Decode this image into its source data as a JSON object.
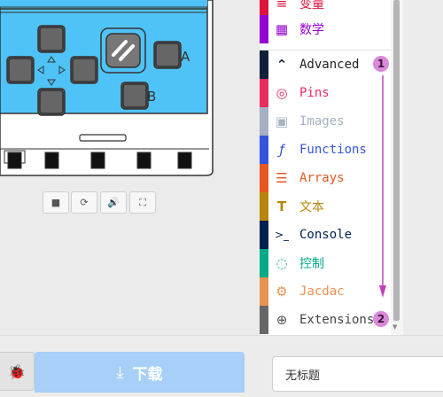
{
  "simulator": {
    "button_a_label": "A",
    "button_b_label": "B",
    "controls": [
      {
        "name": "stop-button",
        "icon": "■"
      },
      {
        "name": "restart-button",
        "icon": "⟳"
      },
      {
        "name": "sound-button",
        "icon": "🔊"
      },
      {
        "name": "fullscreen-button",
        "icon": "⛶"
      }
    ],
    "colors": {
      "board": "#4fc3f7",
      "outline": "#333333"
    }
  },
  "toolbox": {
    "categories": [
      {
        "label": "变量",
        "color": "#dc143c",
        "icon": "≡",
        "partial": true
      },
      {
        "label": "数学",
        "color": "#9400d3",
        "icon": "▦"
      },
      {
        "label": "Advanced",
        "color": "#0f1f3a",
        "icon": "⌃",
        "text_color": "#222222"
      },
      {
        "label": "Pins",
        "color": "#e92c5f",
        "icon": "◎"
      },
      {
        "label": "Images",
        "color": "#a5b1c2",
        "icon": "▣"
      },
      {
        "label": "Functions",
        "color": "#3455db",
        "icon": "ƒ"
      },
      {
        "label": "Arrays",
        "color": "#e65722",
        "icon": "☰"
      },
      {
        "label": "文本",
        "color": "#b8860b",
        "icon": "T"
      },
      {
        "label": "Console",
        "color": "#002050",
        "icon": ">_"
      },
      {
        "label": "控制",
        "color": "#00aa88",
        "icon": "◌"
      },
      {
        "label": "Jacdac",
        "color": "#e79351",
        "icon": "⚙"
      },
      {
        "label": "Extensions",
        "color": "#666666",
        "icon": "⊕",
        "text_color": "#444444"
      }
    ]
  },
  "annotations": {
    "marker_1": "1",
    "marker_2": "2",
    "color": "#c040c0"
  },
  "footer": {
    "download_label": "下载",
    "download_icon": "⤓",
    "project_name": "无标题",
    "bug_icon": "bug-icon"
  }
}
